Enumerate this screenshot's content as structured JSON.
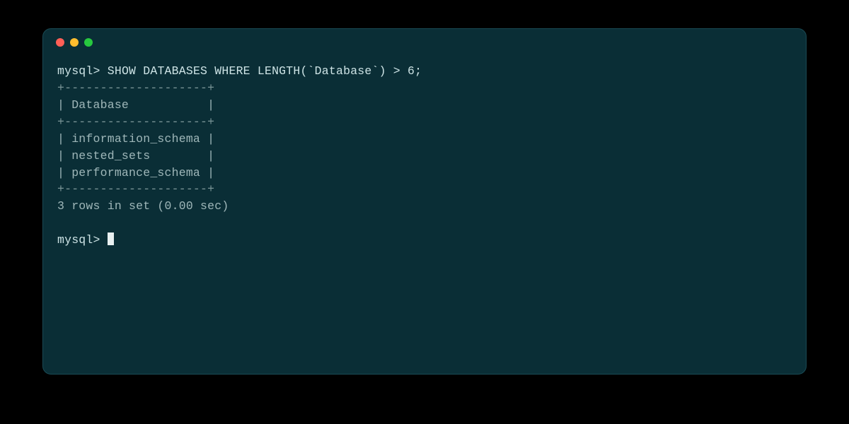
{
  "terminal": {
    "prompt": "mysql>",
    "command": "SHOW DATABASES WHERE LENGTH(`Database`) > 6;",
    "divider": "+--------------------+",
    "header_row": "| Database           |",
    "rows": [
      "| information_schema |",
      "| nested_sets        |",
      "| performance_schema |"
    ],
    "status": "3 rows in set (0.00 sec)",
    "colors": {
      "bg": "#0a2e36",
      "fg": "#9fb7b9",
      "fg_bright": "#cde3e5"
    }
  }
}
